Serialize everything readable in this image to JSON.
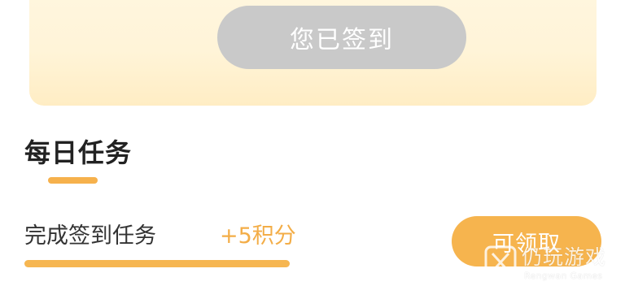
{
  "checkin": {
    "button_label": "您已签到"
  },
  "daily_tasks": {
    "title": "每日任务",
    "tasks": [
      {
        "label": "完成签到任务",
        "reward": "+5积分",
        "progress": 1.0,
        "action_label": "可领取"
      }
    ]
  },
  "watermark": {
    "text": "仍玩游戏",
    "subtext": "Rengwan Games"
  },
  "colors": {
    "accent": "#f6b44e",
    "disabled_button": "#c9c9c9",
    "card_bg_top": "#fff6df",
    "card_bg_bottom": "#ffedc4",
    "title_text": "#222222"
  }
}
